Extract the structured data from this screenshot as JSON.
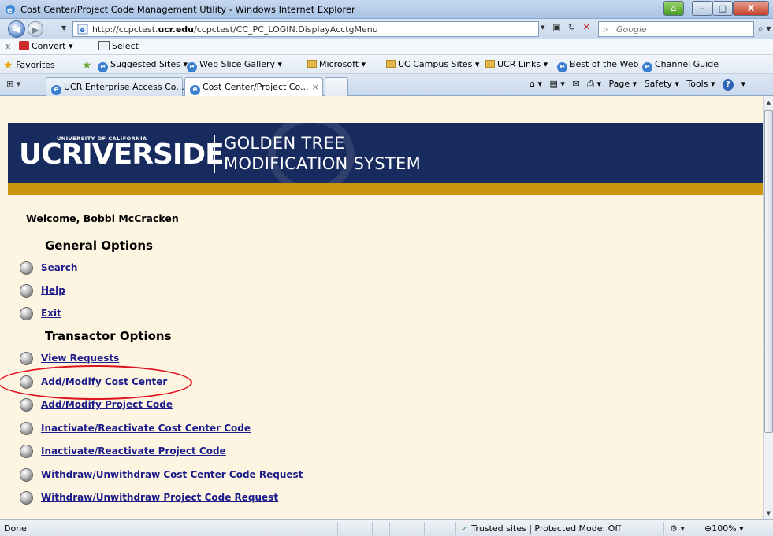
{
  "window": {
    "title": "Cost Center/Project Code Management Utility - Windows Internet Explorer",
    "controls": {
      "minimize": "–",
      "maximize": "□",
      "close": "X"
    }
  },
  "address_bar": {
    "url_prefix": "http://ccpctest.",
    "url_domain": "ucr.edu",
    "url_suffix": "/ccpctest/CC_PC_LOGIN.DisplayAcctgMenu",
    "search_placeholder": "Google"
  },
  "convert_toolbar": {
    "close": "x",
    "convert_label": "Convert ▾",
    "select_label": "Select"
  },
  "favorites_bar": {
    "favorites_label": "Favorites",
    "items": [
      "Suggested Sites ▾",
      "Web Slice Gallery ▾",
      "Microsoft ▾",
      "UC Campus Sites ▾",
      "UCR Links ▾",
      "Best of the Web",
      "Channel Guide"
    ]
  },
  "tabs": {
    "items": [
      {
        "label": "UCR Enterprise Access Co..."
      },
      {
        "label": "Cost Center/Project Co...",
        "active": true
      }
    ],
    "close_glyph": "×"
  },
  "command_bar": {
    "page": "Page ▾",
    "safety": "Safety ▾",
    "tools": "Tools ▾",
    "help": "?"
  },
  "banner": {
    "logo_uc": "UCRIVERSIDE",
    "logo_university": "UNIVERSITY OF CALIFORNIA",
    "system_line1": "GOLDEN TREE",
    "system_line2": "MODIFICATION SYSTEM"
  },
  "page": {
    "welcome": "Welcome, Bobbi McCracken",
    "general_heading": "General Options",
    "general_options": [
      "Search",
      "Help",
      "Exit"
    ],
    "transactor_heading": "Transactor Options",
    "transactor_options": [
      "View Requests",
      "Add/Modify Cost Center",
      "Add/Modify Project Code",
      "Inactivate/Reactivate Cost Center Code",
      "Inactivate/Reactivate Project Code",
      "Withdraw/Unwithdraw Cost Center Code Request",
      "Withdraw/Unwithdraw Project Code Request"
    ],
    "highlighted_option": "Add/Modify Cost Center"
  },
  "status_bar": {
    "status": "Done",
    "zone": "Trusted sites | Protected Mode: Off",
    "zoom": "100%"
  },
  "colors": {
    "banner_navy": "#182b5f",
    "gold_bar": "#c8950f",
    "page_bg": "#fdf4e2",
    "link": "#1b1b8a",
    "highlight_ring": "#e0141e"
  }
}
